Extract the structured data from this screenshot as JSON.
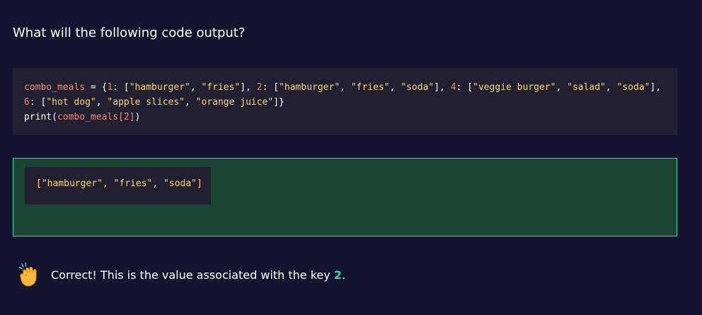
{
  "question": "What will the following code output?",
  "code": {
    "var": "combo_meals",
    "eq": " = {",
    "k1": "1",
    "v1": [
      "\"hamburger\"",
      "\"fries\""
    ],
    "k2": "2",
    "v2": [
      "\"hamburger\"",
      "\"fries\"",
      "\"soda\""
    ],
    "k4": "4",
    "v4": [
      "\"veggie burger\"",
      "\"salad\"",
      "\"soda\""
    ],
    "k6": "6",
    "v6": [
      "\"hot dog\"",
      "\"apple slices\"",
      "\"orange juice\""
    ],
    "print_fn": "print",
    "print_arg": "combo_meals",
    "print_idx": "2"
  },
  "answer": {
    "text": "[\"hamburger\", \"fries\", \"soda\"]",
    "state": "correct",
    "accent": "#3dd6a6"
  },
  "feedback": {
    "icon": "clapping-hands-icon",
    "text": "Correct! This is the value associated with the key ",
    "key": "2",
    "period": "."
  }
}
